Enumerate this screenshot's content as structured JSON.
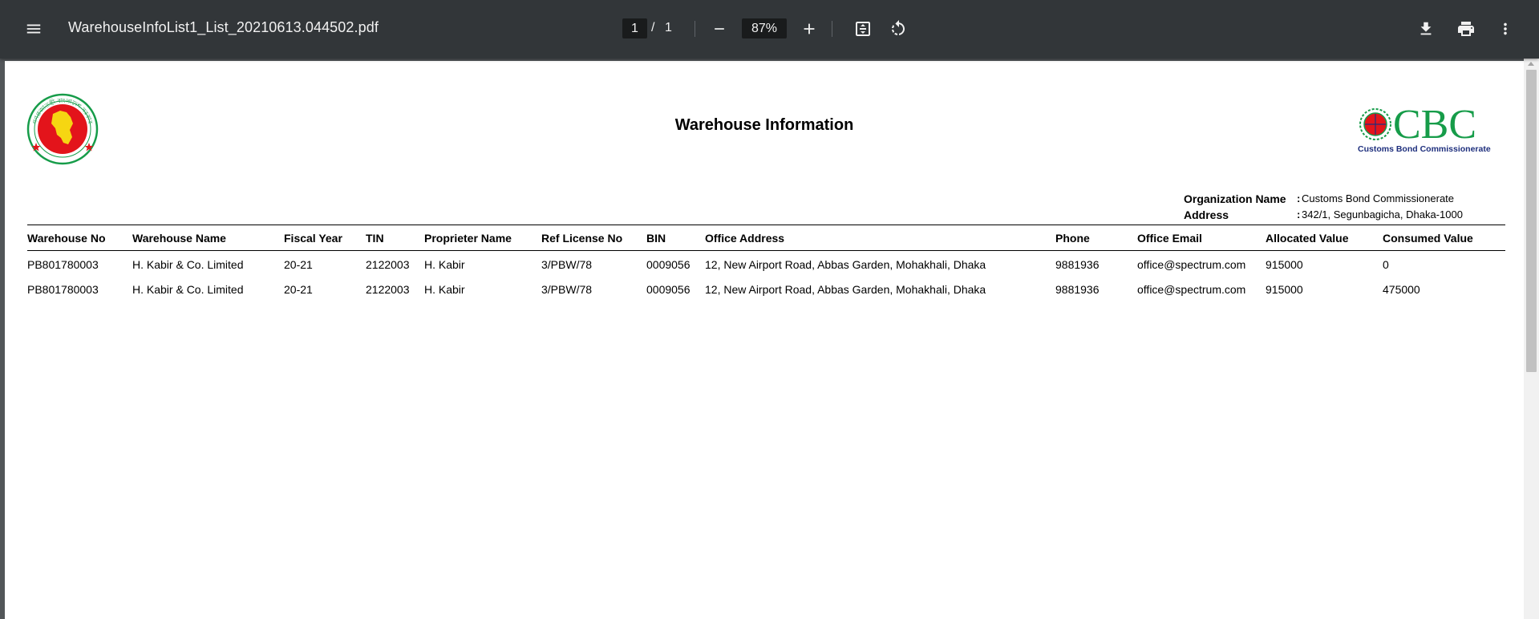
{
  "toolbar": {
    "file_name": "WarehouseInfoList1_List_20210613.044502.pdf",
    "current_page": "1",
    "page_separator": "/",
    "total_pages": "1",
    "zoom": "87%",
    "icons": [
      "menu-icon",
      "zoom-out-icon",
      "zoom-in-icon",
      "fit-to-page-icon",
      "rotate-icon",
      "download-icon",
      "print-icon",
      "more-vert-icon"
    ],
    "background_color": "#323639"
  },
  "report": {
    "title": "Warehouse Information",
    "cbc_logo_text": "CBC",
    "cbc_logo_subtitle": "Customs Bond Commissionerate",
    "gov_logo_text": "গণপ্রজাতন্ত্রী বাংলাদেশ সরকার",
    "organization": {
      "label": "Organization Name",
      "colon": ":",
      "value": "Customs Bond Commissionerate"
    },
    "address": {
      "label": "Address",
      "colon": ":",
      "value": "342/1, Segunbagicha, Dhaka-1000"
    },
    "columns": [
      "Warehouse No",
      "Warehouse Name",
      "Fiscal Year",
      "TIN",
      "Proprieter Name",
      "Ref License No",
      "BIN",
      "Office Address",
      "Phone",
      "Office Email",
      "Allocated Value",
      "Consumed Value"
    ],
    "rows": [
      [
        "PB801780003",
        "H. Kabir & Co. Limited",
        "20-21",
        "2122003",
        "H. Kabir",
        "3/PBW/78",
        "0009056",
        "12, New Airport Road, Abbas Garden, Mohakhali, Dhaka",
        "9881936",
        "office@spectrum.com",
        "915000",
        "0"
      ],
      [
        "PB801780003",
        "H. Kabir & Co. Limited",
        "20-21",
        "2122003",
        "H. Kabir",
        "3/PBW/78",
        "0009056",
        "12, New Airport Road, Abbas Garden, Mohakhali, Dhaka",
        "9881936",
        "office@spectrum.com",
        "915000",
        "475000"
      ]
    ]
  },
  "colors": {
    "viewer_background": "#525659",
    "page_background": "#ffffff",
    "logo_green": "#169c49",
    "logo_red": "#e3141b",
    "logo_navy": "#1e2f7d"
  }
}
